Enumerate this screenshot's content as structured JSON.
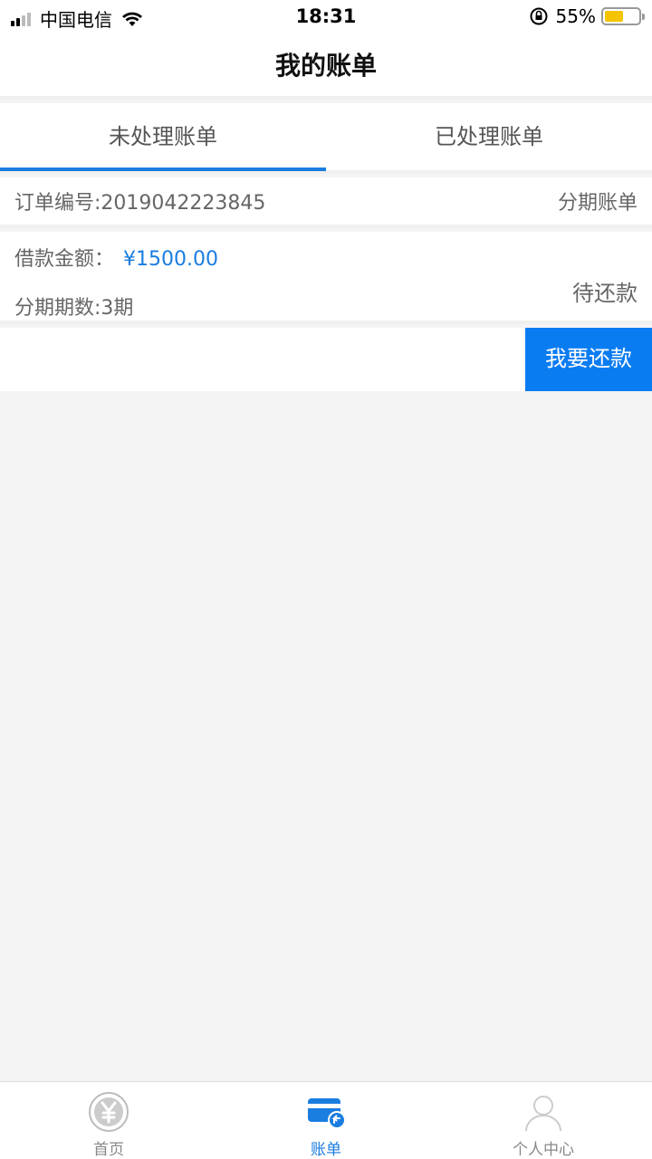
{
  "status_bar": {
    "carrier": "中国电信",
    "time": "18:31",
    "battery": "55%"
  },
  "nav": {
    "title": "我的账单"
  },
  "tabs": [
    {
      "label": "未处理账单",
      "active": true
    },
    {
      "label": "已处理账单",
      "active": false
    }
  ],
  "order": {
    "number_label": "订单编号:2019042223845",
    "type": "分期账单",
    "amount_label": "借款金额：",
    "amount_value": "¥1500.00",
    "periods_label": "分期期数:3期",
    "status": "待还款",
    "repay_button": "我要还款"
  },
  "bottom_tabs": [
    {
      "label": "首页",
      "icon": "yen-icon",
      "active": false
    },
    {
      "label": "账单",
      "icon": "bill-card-icon",
      "active": true
    },
    {
      "label": "个人中心",
      "icon": "person-icon",
      "active": false
    }
  ],
  "colors": {
    "accent": "#1a7de0",
    "button": "#0a7cf2",
    "background": "#f4f4f4"
  }
}
